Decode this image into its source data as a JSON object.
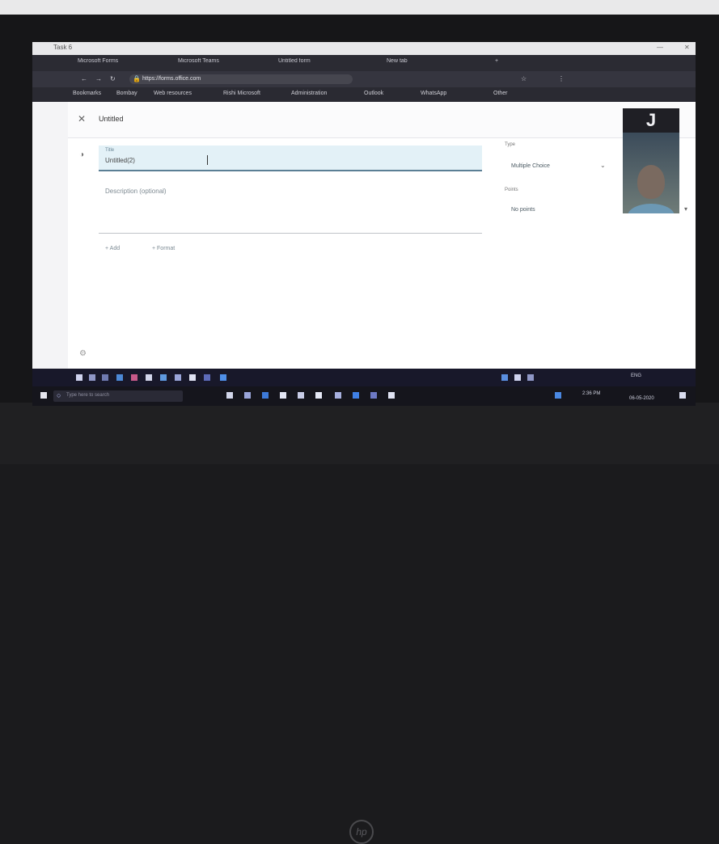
{
  "browser": {
    "window_title": "Task 6",
    "tabs": [
      {
        "label": "Microsoft Forms"
      },
      {
        "label": "Microsoft Teams"
      },
      {
        "label": "Untitled form"
      },
      {
        "label": "New tab"
      }
    ],
    "address": "https://forms.office.com",
    "bookmarks": [
      {
        "label": "Bookmarks"
      },
      {
        "label": "Bombay"
      },
      {
        "label": "Web resources"
      },
      {
        "label": "Rishi Microsoft"
      },
      {
        "label": "Administration"
      },
      {
        "label": "Outlook"
      },
      {
        "label": "WhatsApp"
      },
      {
        "label": "Other"
      }
    ]
  },
  "webcam": {
    "initial": "J"
  },
  "app": {
    "title": "Untitled",
    "title_field_label": "Title",
    "title_field_value": "Untitled(2)",
    "description_placeholder": "Description (optional)",
    "add_label": "+ Add",
    "format_label": "+ Format",
    "side": {
      "type_label": "Type",
      "type_value": "Multiple Choice",
      "points_label": "Points",
      "points_value": "No points"
    }
  },
  "taskbar": {
    "search_placeholder": "Type here to search",
    "time": "2:36 PM",
    "date": "06-05-2020",
    "tray_lang": "ENG"
  },
  "laptop": {
    "brand": "hp"
  },
  "colors": {
    "accent": "#5b7f95",
    "field_fill": "#e3f1f7",
    "taskbar": "#15151c"
  }
}
